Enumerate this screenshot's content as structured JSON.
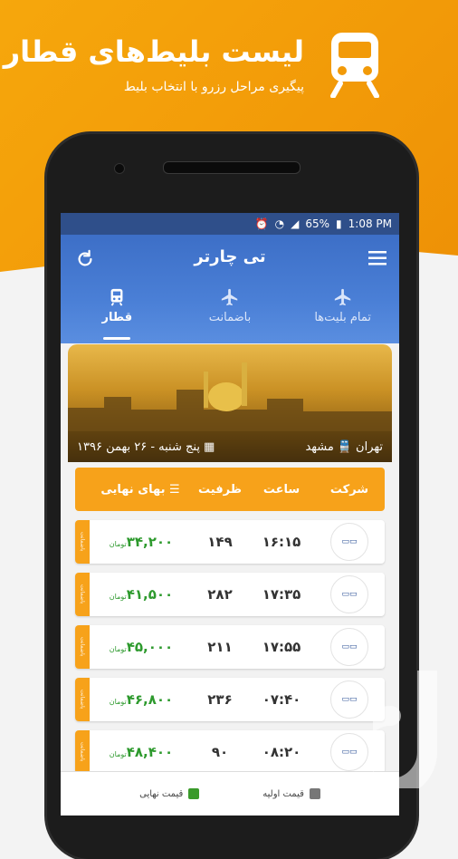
{
  "promo": {
    "title": "لیست بلیط‌های قطار",
    "subtitle": "پیگیری مراحل رزرو با انتخاب بلیط"
  },
  "status_bar": {
    "battery": "65%",
    "time": "1:08 PM"
  },
  "app": {
    "title": "تی چارتر",
    "tabs": [
      {
        "label": "تمام بلیت‌ها",
        "icon": "airplane-icon",
        "active": false
      },
      {
        "label": "باضمانت",
        "icon": "airplane-icon",
        "active": false
      },
      {
        "label": "قطار",
        "icon": "train-icon",
        "active": true
      }
    ]
  },
  "route": {
    "origin": "تهران",
    "destination": "مشهد",
    "date": "پنج شنبه - ۲۶ بهمن ۱۳۹۶"
  },
  "table": {
    "headers": {
      "company": "شرکت",
      "time": "ساعت",
      "capacity": "ظرفیت",
      "price": "بهای نهایی"
    },
    "rows": [
      {
        "time": "۱۶:۱۵",
        "capacity": "۱۴۹",
        "price": "۳۴,۲۰۰",
        "currency": "تومان",
        "tag": "باضمانت",
        "logo": "rail-logo-1"
      },
      {
        "time": "۱۷:۳۵",
        "capacity": "۲۸۲",
        "price": "۴۱,۵۰۰",
        "currency": "تومان",
        "tag": "باضمانت",
        "logo": "rail-logo-2"
      },
      {
        "time": "۱۷:۵۵",
        "capacity": "۲۱۱",
        "price": "۴۵,۰۰۰",
        "currency": "تومان",
        "tag": "باضمانت",
        "logo": "rail-logo-3"
      },
      {
        "time": "۰۷:۴۰",
        "capacity": "۲۳۶",
        "price": "۴۶,۸۰۰",
        "currency": "تومان",
        "tag": "باضمانت",
        "logo": "rail-logo-2"
      },
      {
        "time": "۰۸:۲۰",
        "capacity": "۹۰",
        "price": "۴۸,۴۰۰",
        "currency": "تومان",
        "tag": "باضمانت",
        "logo": "rail-logo-4"
      }
    ]
  },
  "legend": {
    "base_price": "قیمت اولیه",
    "final_price": "قیمت نهایی",
    "base_color": "#777777",
    "final_color": "#3a9a2a"
  },
  "colors": {
    "accent_orange": "#f7a21a",
    "app_blue": "#3d6fc7",
    "price_green": "#2e9a2e"
  }
}
